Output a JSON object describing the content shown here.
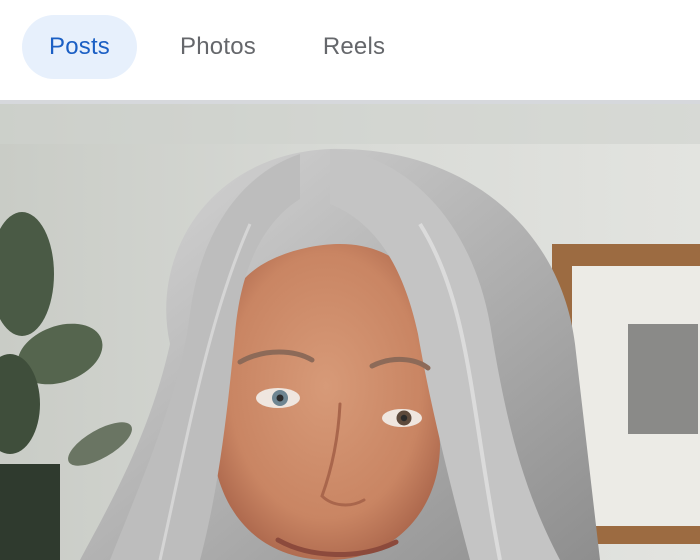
{
  "tabs": [
    {
      "label": "Posts",
      "active": true
    },
    {
      "label": "Photos",
      "active": false
    },
    {
      "label": "Reels",
      "active": false
    }
  ],
  "colors": {
    "active_tab_bg": "#e7f0fc",
    "active_tab_text": "#1b5fc4",
    "inactive_tab_text": "#65676b",
    "divider": "#d6d8dc"
  },
  "post_photo": {
    "content": "selfie of a smiling woman with long silver hair in a living room"
  }
}
